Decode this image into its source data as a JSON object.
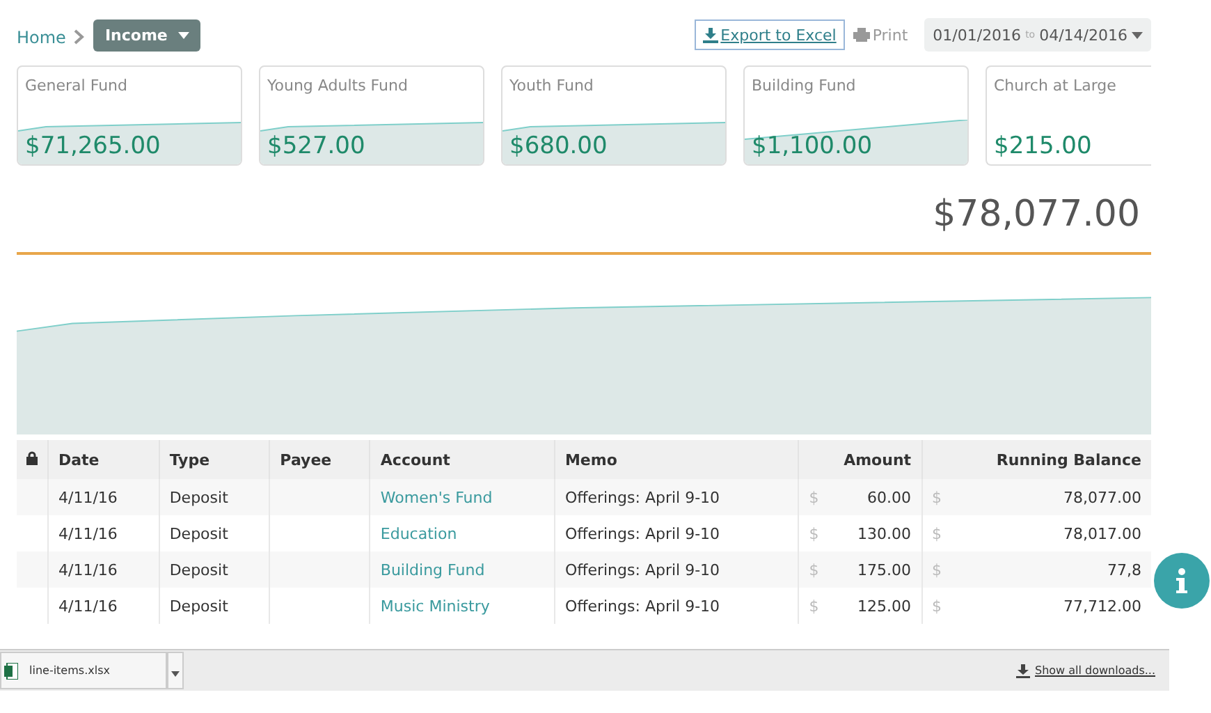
{
  "breadcrumb": {
    "home": "Home",
    "current": "Income"
  },
  "toolbar": {
    "export": "Export to Excel",
    "print": "Print",
    "date_from": "01/01/2016",
    "date_sep": "to",
    "date_to": "04/14/2016"
  },
  "funds": [
    {
      "name": "General Fund",
      "amount": "$71,265.00"
    },
    {
      "name": "Young Adults Fund",
      "amount": "$527.00"
    },
    {
      "name": "Youth Fund",
      "amount": "$680.00"
    },
    {
      "name": "Building Fund",
      "amount": "$1,100.00"
    },
    {
      "name": "Church at Large",
      "amount": "$215.00"
    }
  ],
  "total": "$78,077.00",
  "table": {
    "columns": [
      "Date",
      "Type",
      "Payee",
      "Account",
      "Memo",
      "Amount",
      "Running Balance"
    ],
    "currency": "$",
    "rows": [
      {
        "date": "4/11/16",
        "type": "Deposit",
        "payee": "",
        "account": "Women's Fund",
        "memo": "Offerings: April 9-10",
        "amount": "60.00",
        "balance": "78,077.00"
      },
      {
        "date": "4/11/16",
        "type": "Deposit",
        "payee": "",
        "account": "Education",
        "memo": "Offerings: April 9-10",
        "amount": "130.00",
        "balance": "78,017.00"
      },
      {
        "date": "4/11/16",
        "type": "Deposit",
        "payee": "",
        "account": "Building Fund",
        "memo": "Offerings: April 9-10",
        "amount": "175.00",
        "balance": "77,8"
      },
      {
        "date": "4/11/16",
        "type": "Deposit",
        "payee": "",
        "account": "Music Ministry",
        "memo": "Offerings: April 9-10",
        "amount": "125.00",
        "balance": "77,712.00"
      }
    ]
  },
  "downloads": {
    "file": "line-items.xlsx",
    "show_all": "Show all downloads..."
  }
}
